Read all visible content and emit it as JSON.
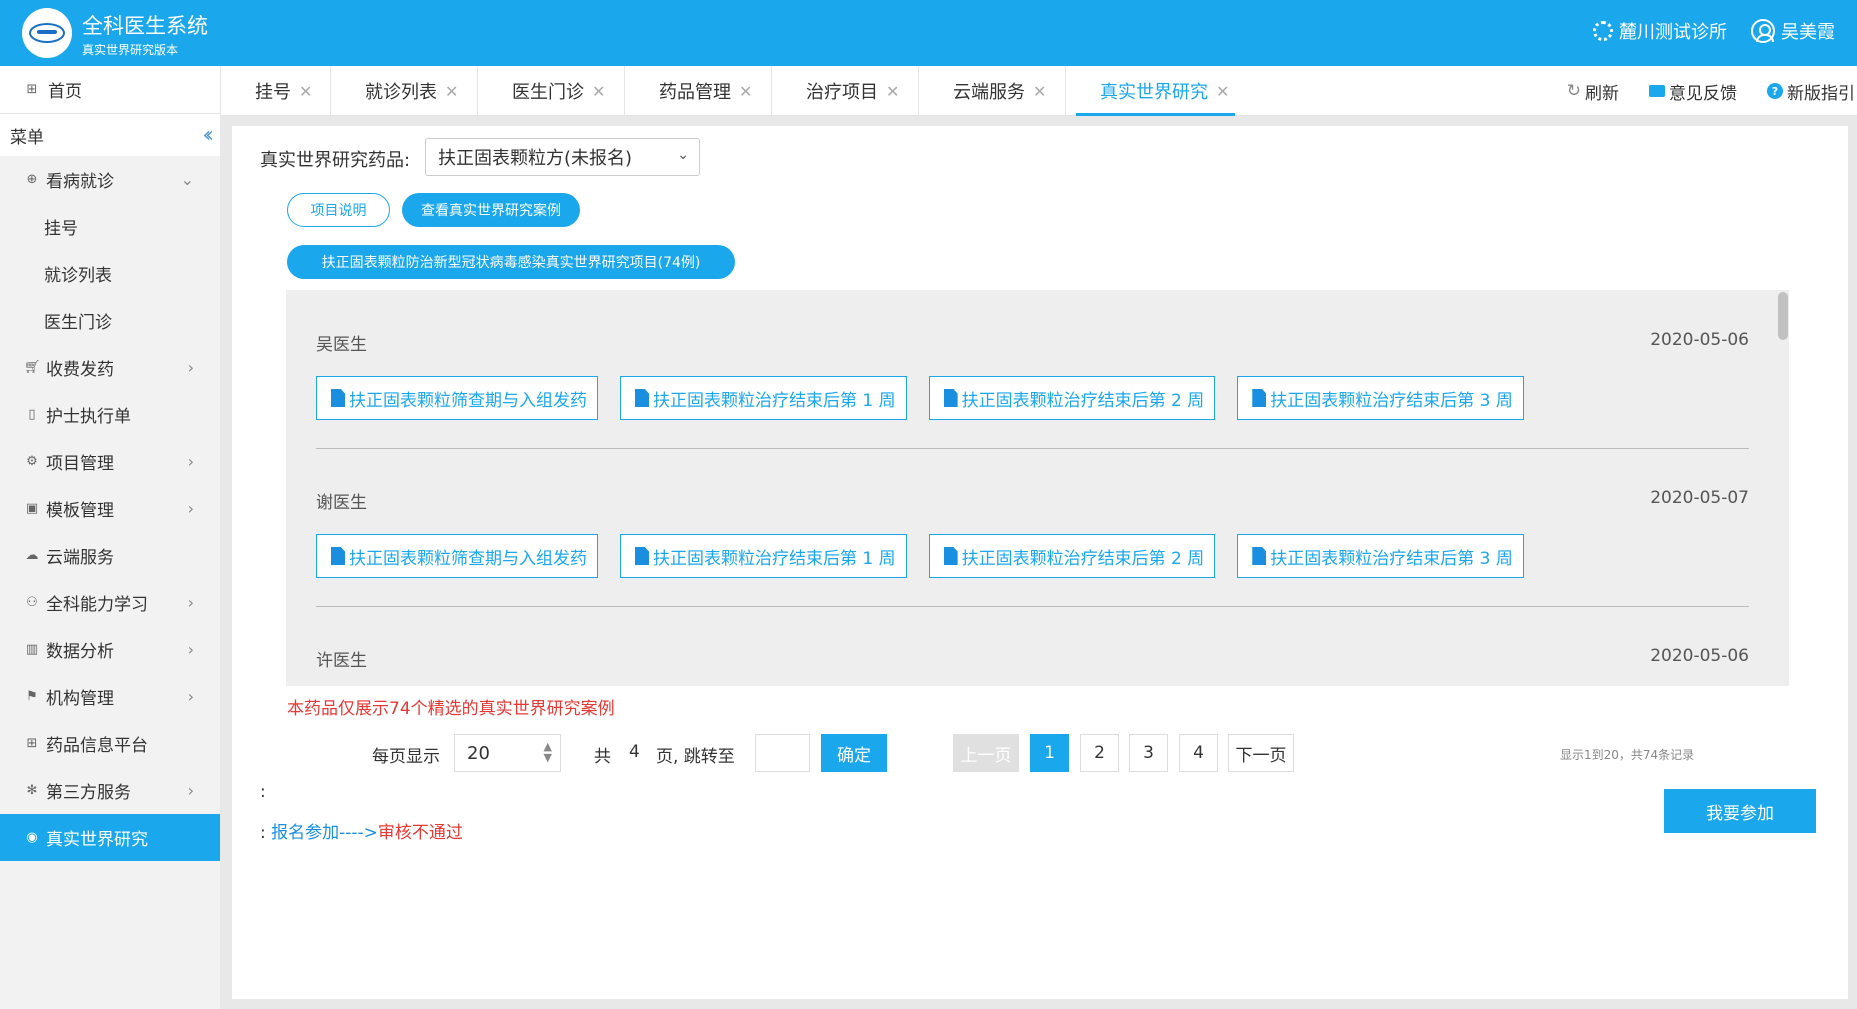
{
  "header": {
    "app_title": "全科医生系统",
    "app_subtitle": "真实世界研究版本",
    "clinic_name": "麓川测试诊所",
    "user_name": "吴美霞"
  },
  "sidebar": {
    "home": "首页",
    "menu_title": "菜单",
    "items": [
      {
        "label": "看病就诊",
        "icon": "clinic-icon",
        "expanded": true
      },
      {
        "label": "收费发药",
        "icon": "cart-icon"
      },
      {
        "label": "护士执行单",
        "icon": "document-icon"
      },
      {
        "label": "项目管理",
        "icon": "project-icon"
      },
      {
        "label": "模板管理",
        "icon": "template-icon"
      },
      {
        "label": "云端服务",
        "icon": "cloud-icon"
      },
      {
        "label": "全科能力学习",
        "icon": "learning-icon"
      },
      {
        "label": "数据分析",
        "icon": "chart-icon"
      },
      {
        "label": "机构管理",
        "icon": "flag-icon"
      },
      {
        "label": "药品信息平台",
        "icon": "medicine-icon"
      },
      {
        "label": "第三方服务",
        "icon": "service-icon"
      },
      {
        "label": "真实世界研究",
        "icon": "research-icon",
        "active": true
      }
    ],
    "subitems": [
      "挂号",
      "就诊列表",
      "医生门诊"
    ]
  },
  "tabs": [
    {
      "label": "挂号"
    },
    {
      "label": "就诊列表"
    },
    {
      "label": "医生门诊"
    },
    {
      "label": "药品管理"
    },
    {
      "label": "治疗项目"
    },
    {
      "label": "云端服务"
    },
    {
      "label": "真实世界研究",
      "active": true
    }
  ],
  "tab_actions": {
    "refresh": "刷新",
    "feedback": "意见反馈",
    "guide": "新版指引"
  },
  "main": {
    "drug_label": "真实世界研究药品:",
    "drug_selected": "扶正固表颗粒方(未报名)",
    "btn_project_desc": "项目说明",
    "btn_view_cases": "查看真实世界研究案例",
    "project_title": "扶正固表颗粒防治新型冠状病毒感染真实世界研究项目(74例)",
    "cases": [
      {
        "doctor": "吴医生",
        "date": "2020-05-06",
        "links": [
          "扶正固表颗粒筛查期与入组发药",
          "扶正固表颗粒治疗结束后第 1 周",
          "扶正固表颗粒治疗结束后第 2 周",
          "扶正固表颗粒治疗结束后第 3 周"
        ]
      },
      {
        "doctor": "谢医生",
        "date": "2020-05-07",
        "links": [
          "扶正固表颗粒筛查期与入组发药",
          "扶正固表颗粒治疗结束后第 1 周",
          "扶正固表颗粒治疗结束后第 2 周",
          "扶正固表颗粒治疗结束后第 3 周"
        ]
      },
      {
        "doctor": "许医生",
        "date": "2020-05-06",
        "links": []
      }
    ],
    "notice": "本药品仅展示74个精选的真实世界研究案例",
    "pager": {
      "per_page_label": "每页显示",
      "per_page": "20",
      "total_prefix": "共",
      "total_pages": "4",
      "jump_label": "页, 跳转至",
      "ok": "确定",
      "prev": "上一页",
      "pages": [
        "1",
        "2",
        "3",
        "4"
      ],
      "current": "1",
      "next": "下一页",
      "summary": "显示1到20，共74条记录"
    },
    "colon": ":",
    "status_signup": "报名参加---->",
    "status_reject": "审核不通过",
    "join_button": "我要参加"
  }
}
